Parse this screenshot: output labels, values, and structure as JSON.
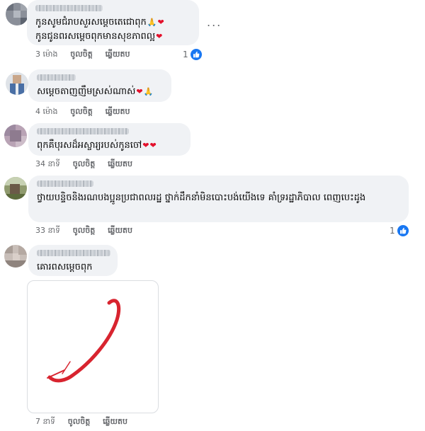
{
  "comments": [
    {
      "text_lines": [
        "កូនសូមជំរាបសួរសម្តេចតេជោពុក",
        "កូនជូនពរសម្តេចពុកមានសុខភាពល្អ"
      ],
      "time": "3 ម៉ោង",
      "like_label": "ចូលចិត្ត",
      "reply_label": "ឆ្លើយតប",
      "reaction_count": "1",
      "more_label": "..."
    },
    {
      "text_lines": [
        "សម្តេចតាញញឹមស្រស់ណាស់"
      ],
      "time": "4 ម៉ោង",
      "like_label": "ចូលចិត្ត",
      "reply_label": "ឆ្លើយតប"
    },
    {
      "text_lines": [
        "ពុកគឺបុរសដ៏អស្ចារ្យរបស់កូនចៅ"
      ],
      "time": "34 នាទី",
      "like_label": "ចូលចិត្ត",
      "reply_label": "ឆ្លើយតប"
    },
    {
      "text_lines": [
        "ថ្វាយបន្ទិចនិងរណបងប្អូនប្រជាពលរដ្ឋ ថ្នាក់ដឹកនាំមិនបោះបង់យើងទេ គាំទ្ររដ្ឋាភិបាល ពេញបេះដូង"
      ],
      "time": "33 នាទី",
      "like_label": "ចូលចិត្ត",
      "reply_label": "ឆ្លើយតប",
      "reaction_count": "1"
    },
    {
      "text_lines": [
        "គោរពសម្តេចពុក"
      ],
      "time": "7 នាទី",
      "like_label": "ចូលចិត្ត",
      "reply_label": "ឆ្លើយតប"
    }
  ],
  "icons": {
    "heart": "❤",
    "pray": "🙏",
    "like": "like-icon"
  },
  "colors": {
    "bubble": "#f0f2f5",
    "meta": "#65676b",
    "like_blue": "#1877f2",
    "heart_red": "#e3102b",
    "sticker_stroke": "#d8242f"
  }
}
